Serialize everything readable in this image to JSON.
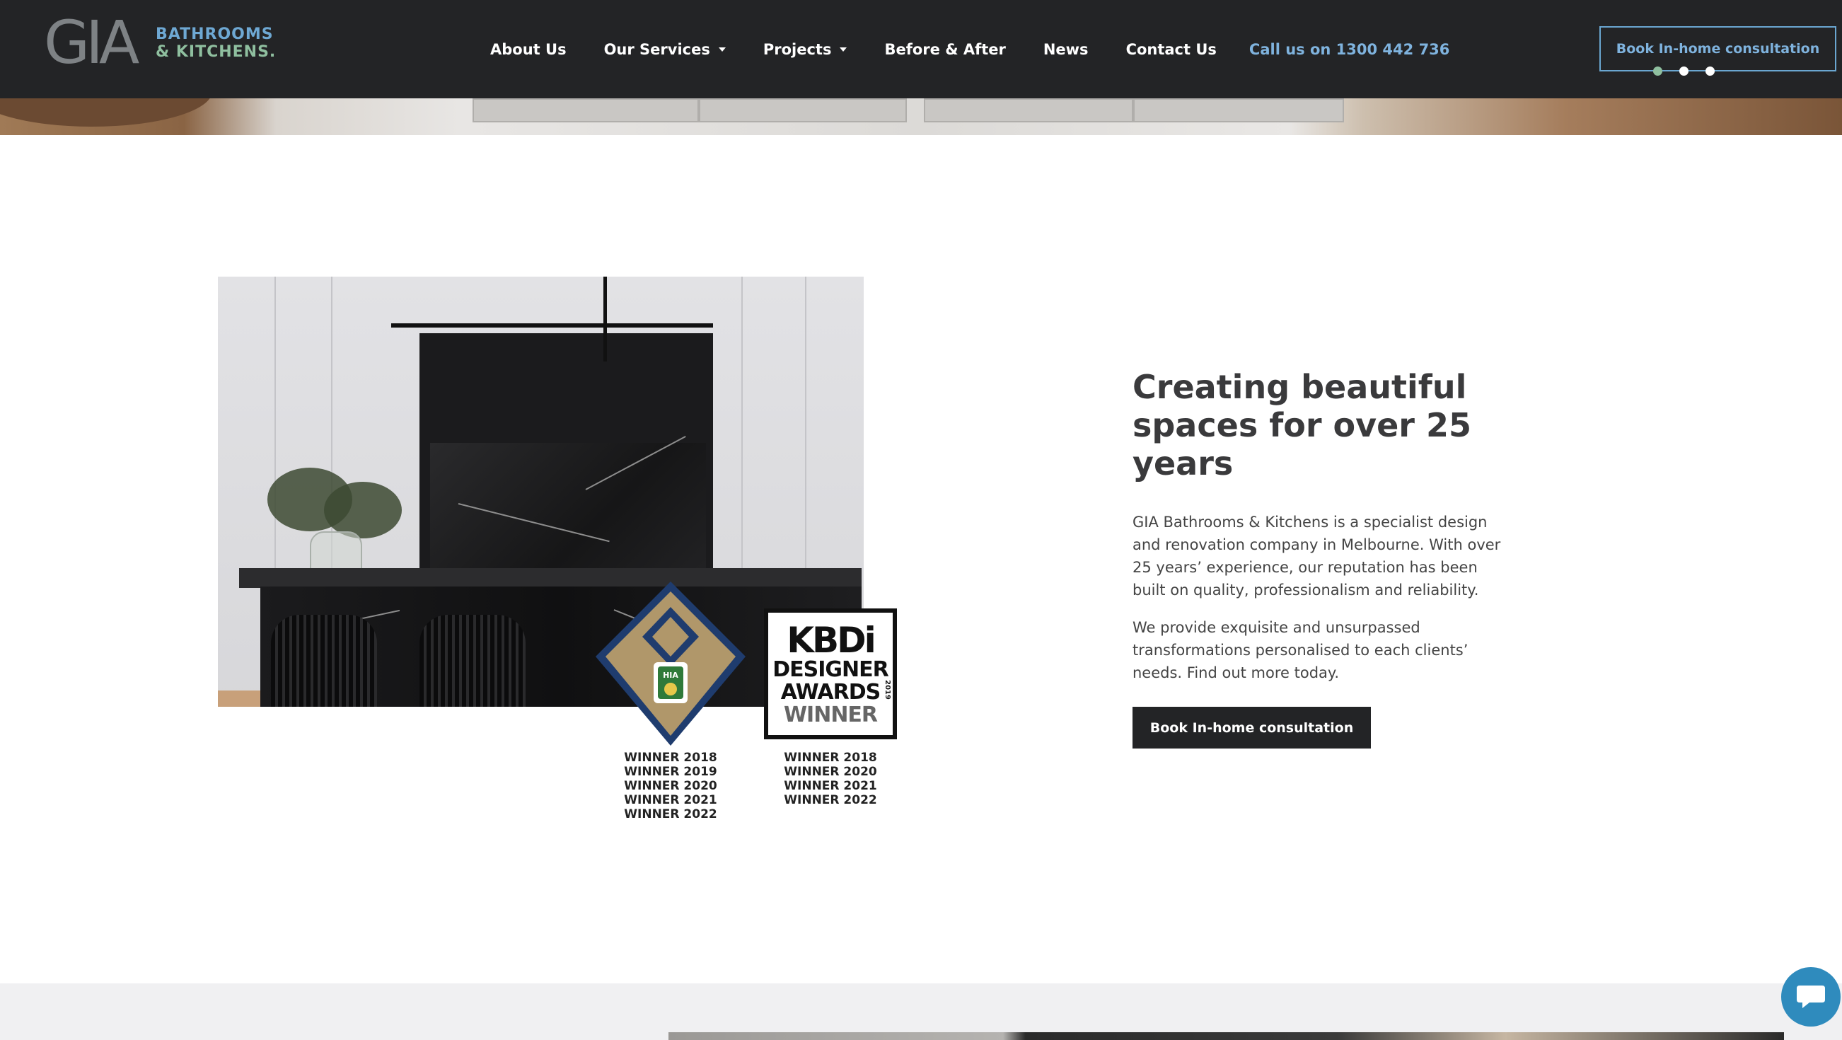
{
  "header": {
    "logo": {
      "main": "GIA",
      "line1": "BATHROOMS",
      "line2": "& KITCHENS."
    },
    "nav": [
      {
        "label": "About Us",
        "dropdown": false
      },
      {
        "label": "Our Services",
        "dropdown": true
      },
      {
        "label": "Projects",
        "dropdown": true
      },
      {
        "label": "Before & After",
        "dropdown": false
      },
      {
        "label": "News",
        "dropdown": false
      },
      {
        "label": "Contact Us",
        "dropdown": false
      }
    ],
    "phone": "Call us on 1300 442 736",
    "cta": "Book In-home consultation",
    "slider_dots": 3,
    "active_dot": 1
  },
  "awards": {
    "hia": {
      "badge_text": "HIA",
      "wins": [
        "WINNER 2018",
        "WINNER 2019",
        "WINNER 2020",
        "WINNER 2021",
        "WINNER 2022"
      ]
    },
    "kbdi": {
      "title": "KBDi",
      "line1": "DESIGNER",
      "line2": "AWARDS",
      "line3": "WINNER",
      "year": "2019",
      "wins": [
        "WINNER 2018",
        "WINNER 2020",
        "WINNER 2021",
        "WINNER 2022"
      ]
    }
  },
  "intro": {
    "headline": "Creating beautiful spaces for over 25 years",
    "paragraph1": "GIA Bathrooms & Kitchens is a specialist design and renovation company in Melbourne. With over 25 years’ experience, our reputation has been built on quality, professionalism and reliability.",
    "paragraph2": "We provide exquisite and unsurpassed transformations personalised to each clients’ needs. Find out more today.",
    "cta": "Book In-home consultation"
  },
  "colors": {
    "header_bg": "#232426",
    "accent_blue": "#7fb3de",
    "accent_green": "#8fbf9f",
    "chat_blue": "#2f8bbd"
  },
  "icons": {
    "chat": "chat-icon",
    "dropdown": "chevron-down-icon"
  }
}
